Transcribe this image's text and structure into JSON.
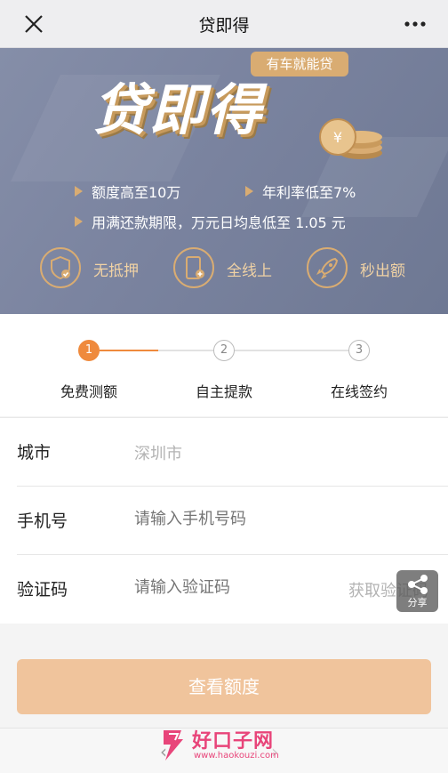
{
  "header": {
    "title": "贷即得"
  },
  "banner": {
    "badge": "有车就能贷",
    "headline": "贷即得",
    "features": [
      "额度高至10万",
      "年利率低至7%",
      "用满还款期限，万元日均息低至 1.05 元"
    ],
    "icons": [
      {
        "label": "无抵押",
        "icon": "shield-check-icon"
      },
      {
        "label": "全线上",
        "icon": "phone-plus-icon"
      },
      {
        "label": "秒出额",
        "icon": "rocket-icon"
      }
    ]
  },
  "steps": [
    {
      "num": "1",
      "label": "免费测额",
      "active": true
    },
    {
      "num": "2",
      "label": "自主提款",
      "active": false
    },
    {
      "num": "3",
      "label": "在线签约",
      "active": false
    }
  ],
  "form": {
    "city_label": "城市",
    "city_value": "深圳市",
    "phone_label": "手机号",
    "phone_placeholder": "请输入手机号码",
    "code_label": "验证码",
    "code_placeholder": "请输入验证码",
    "get_code": "获取验证码"
  },
  "share": {
    "label": "分享"
  },
  "submit_label": "查看额度",
  "watermark": {
    "main": "好口子网",
    "sub": "www.haokouzi.com"
  },
  "colors": {
    "accent": "#ef8a3d",
    "gold": "#d9ac72",
    "button": "#f0c49c"
  }
}
